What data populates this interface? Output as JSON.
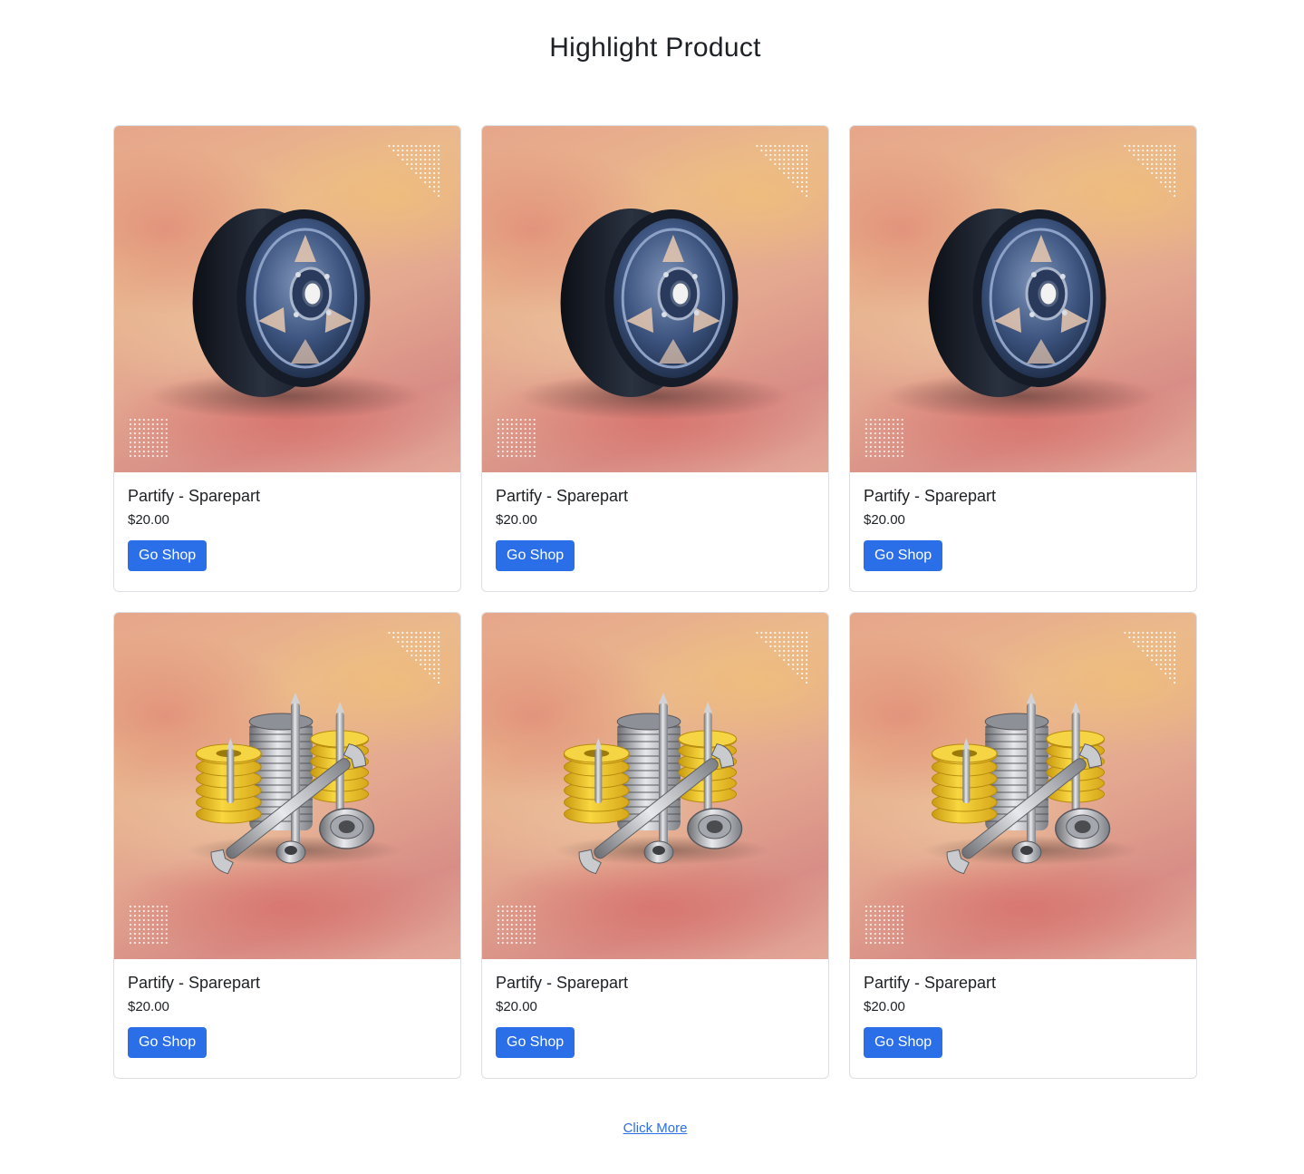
{
  "section": {
    "title": "Highlight Product",
    "more_label": "Click More"
  },
  "products": [
    {
      "title": "Partify - Sparepart",
      "price": "$20.00",
      "button": "Go Shop",
      "image": "wheel-rim"
    },
    {
      "title": "Partify - Sparepart",
      "price": "$20.00",
      "button": "Go Shop",
      "image": "wheel-rim"
    },
    {
      "title": "Partify - Sparepart",
      "price": "$20.00",
      "button": "Go Shop",
      "image": "wheel-rim"
    },
    {
      "title": "Partify - Sparepart",
      "price": "$20.00",
      "button": "Go Shop",
      "image": "tools-parts"
    },
    {
      "title": "Partify - Sparepart",
      "price": "$20.00",
      "button": "Go Shop",
      "image": "tools-parts"
    },
    {
      "title": "Partify - Sparepart",
      "price": "$20.00",
      "button": "Go Shop",
      "image": "tools-parts"
    }
  ],
  "colors": {
    "button": "#2b6fe8",
    "link": "#2b6fe8",
    "card_border": "#dcdfe3"
  }
}
